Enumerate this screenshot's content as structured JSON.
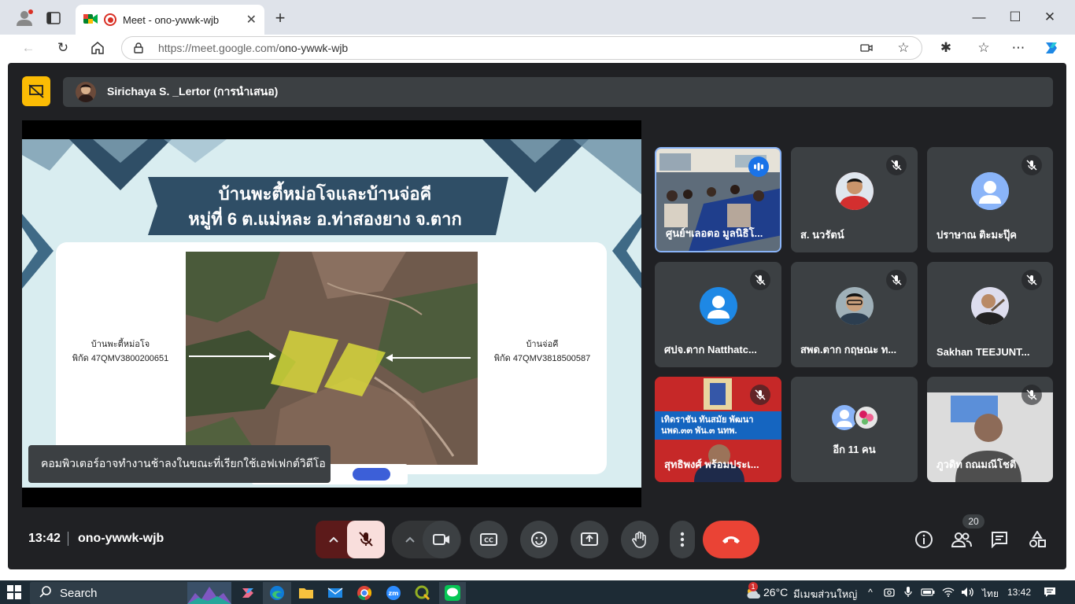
{
  "browser": {
    "tab_title": "Meet - ono-ywwk-wjb",
    "url_host": "https://meet.google.com/",
    "url_path": "ono-ywwk-wjb"
  },
  "meeting": {
    "presenter_banner": "Sirichaya S. _Lertor (การนำเสนอ)",
    "time": "13:42",
    "code": "ono-ywwk-wjb",
    "participants_count": "20",
    "toast": "คอมพิวเตอร์อาจทำงานช้าลงในขณะที่เรียกใช้เอฟเฟกต์วิดีโอ"
  },
  "slide": {
    "title_line1": "บ้านพะตี้หม่อโจและบ้านจ่อคี",
    "title_line2": "หมู่ที่ 6 ต.แม่หละ อ.ท่าสองยาง จ.ตาก",
    "left_label_name": "บ้านพะตี้หม่อโจ",
    "left_label_coord": "พิกัด 47QMV3800200651",
    "right_label_name": "บ้านจ่อคี",
    "right_label_coord": "พิกัด 47QMV3818500587"
  },
  "participants": [
    {
      "name": "ศูนย์ฯเลอตอ มูลนิธิโ...",
      "mic": "speaking"
    },
    {
      "name": "ส. นวรัตน์",
      "mic": "muted"
    },
    {
      "name": "ปราษาณ ติะมะปุ๊ค",
      "mic": "muted"
    },
    {
      "name": "ศปจ.ตาก Natthatc...",
      "mic": "muted"
    },
    {
      "name": "สพด.ตาก กฤษณะ ท...",
      "mic": "muted"
    },
    {
      "name": "Sakhan TEEJUNT...",
      "mic": "muted"
    },
    {
      "name": "สุทธิพงศ์ พร้อมประเ...",
      "mic": "muted"
    },
    {
      "name": "อีก 11 คน",
      "mic": ""
    },
    {
      "name": "ภูวดิท ถณมณีโชติ",
      "mic": "muted"
    }
  ],
  "tile_bg_text": {
    "line1": "เทิดราชัน ทันสมัย พัฒนา",
    "line2": "นพด.๓๓ พัน.๓ นทพ."
  },
  "taskbar": {
    "search": "Search",
    "weather_temp": "26°C",
    "weather_text": "มีเมฆส่วนใหญ่",
    "lang": "ไทย",
    "clock": "13:42",
    "badge": "1"
  },
  "colors": {
    "meet_bg": "#202124",
    "end_call": "#ea4335",
    "speaking": "#8ab4f8"
  }
}
